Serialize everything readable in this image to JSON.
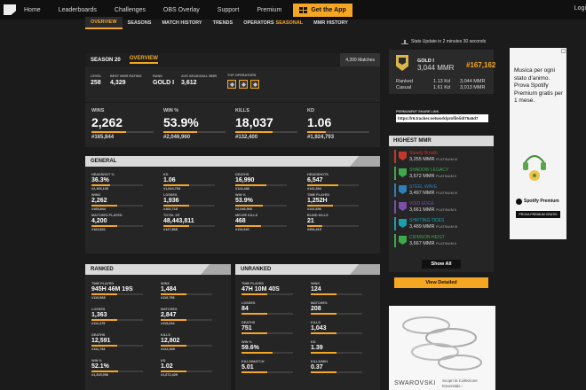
{
  "nav": {
    "items": [
      "Home",
      "Leaderboards",
      "Challenges",
      "OBS Overlay",
      "Support",
      "Premium"
    ],
    "cta": "Get the App",
    "login": "Logi"
  },
  "subtabs": [
    {
      "label": "OVERVIEW",
      "accent": ""
    },
    {
      "label": "SEASONS",
      "accent": ""
    },
    {
      "label": "MATCH HISTORY",
      "accent": ""
    },
    {
      "label": "TRENDS",
      "accent": ""
    },
    {
      "label": "OPERATORS",
      "accent": "SEASONAL"
    },
    {
      "label": "MMR HISTORY",
      "accent": ""
    }
  ],
  "season": {
    "title": "SEASON 20",
    "tab": "OVERVIEW",
    "matches": "4,200 Matches",
    "mini": [
      {
        "label": "LEVEL",
        "value": "258"
      },
      {
        "label": "BEST MMR RATING",
        "value": "4,329"
      },
      {
        "label": "RANK",
        "value": "GOLD I"
      },
      {
        "label": "AVG SEASONAL MMR",
        "value": "3,612"
      }
    ],
    "top_operators_label": "TOP OPERATORS"
  },
  "bigstats": [
    {
      "label": "WINS",
      "value": "2,262",
      "sub": "#165,844",
      "fill": 0.55
    },
    {
      "label": "WIN %",
      "value": "53.9%",
      "sub": "#2,046,960",
      "fill": 0.54
    },
    {
      "label": "KILLS",
      "value": "18,037",
      "sub": "#132,400",
      "fill": 0.6
    },
    {
      "label": "KD",
      "value": "1.06",
      "sub": "#1,924,793",
      "fill": 0.3
    }
  ],
  "general": {
    "title": "GENERAL",
    "cells": [
      {
        "label": "HEADSHOT %",
        "value": "36.3%",
        "sub": "#2,165,105",
        "fill": 0.36
      },
      {
        "label": "KD",
        "value": "1.06",
        "sub": "#1,924,793",
        "fill": 0.5
      },
      {
        "label": "DEATHS",
        "value": "16,990",
        "sub": "#124,486",
        "fill": 0.6
      },
      {
        "label": "HEADSHOTS",
        "value": "6,547",
        "sub": "#141,394",
        "fill": 0.6
      },
      {
        "label": "WINS",
        "value": "2,262",
        "sub": "#165,844",
        "fill": 0.5
      },
      {
        "label": "LOSSES",
        "value": "1,936",
        "sub": "#162,718",
        "fill": 0.5
      },
      {
        "label": "WIN %",
        "value": "53.9%",
        "sub": "#2,046,960",
        "fill": 0.54
      },
      {
        "label": "TIME PLAYED",
        "value": "1,252H",
        "sub": "#131,696",
        "fill": 0.5
      },
      {
        "label": "MATCHES PLAYED",
        "value": "4,200",
        "sub": "#164,831",
        "fill": 0.5
      },
      {
        "label": "TOTAL XP",
        "value": "48,443,811",
        "sub": "#127,868",
        "fill": 0.5
      },
      {
        "label": "MELEE KILLS",
        "value": "468",
        "sub": "#110,540",
        "fill": 0.5
      },
      {
        "label": "BLIND KILLS",
        "value": "21",
        "sub": "#354,415",
        "fill": 0.3
      }
    ]
  },
  "ranked": {
    "title": "RANKED",
    "cells": [
      {
        "label": "TIME PLAYED",
        "value": "945H 46M 19S",
        "sub": "#119,568",
        "fill": 0.5
      },
      {
        "label": "WINS",
        "value": "1,484",
        "sub": "#110,756",
        "fill": 0.5
      },
      {
        "label": "LOSSES",
        "value": "1,363",
        "sub": "#111,375",
        "fill": 0.5
      },
      {
        "label": "MATCHES",
        "value": "2,847",
        "sub": "#115,816",
        "fill": 0.5
      },
      {
        "label": "DEATHS",
        "value": "12,591",
        "sub": "#111,733",
        "fill": 0.5
      },
      {
        "label": "KILLS",
        "value": "12,802",
        "sub": "#122,469",
        "fill": 0.5
      },
      {
        "label": "WIN %",
        "value": "52.1%",
        "sub": "#1,315,096",
        "fill": 0.52
      },
      {
        "label": "KD",
        "value": "1.02",
        "sub": "#1,672,429",
        "fill": 0.5
      }
    ]
  },
  "unranked": {
    "title": "UNRANKED",
    "cells": [
      {
        "label": "TIME PLAYED",
        "value": "47H 10M 40S",
        "sub": "",
        "fill": 0.5
      },
      {
        "label": "WINS",
        "value": "124",
        "sub": "",
        "fill": 0.5
      },
      {
        "label": "LOSSES",
        "value": "84",
        "sub": "",
        "fill": 0.5
      },
      {
        "label": "MATCHES",
        "value": "208",
        "sub": "",
        "fill": 0.5
      },
      {
        "label": "DEATHS",
        "value": "751",
        "sub": "",
        "fill": 0.5
      },
      {
        "label": "KILLS",
        "value": "1,043",
        "sub": "",
        "fill": 0.5
      },
      {
        "label": "WIN %",
        "value": "59.6%",
        "sub": "",
        "fill": 0.6
      },
      {
        "label": "KD",
        "value": "1.39",
        "sub": "",
        "fill": 0.5
      },
      {
        "label": "KILLS/MATCH",
        "value": "5.01",
        "sub": "",
        "fill": 0.5
      },
      {
        "label": "KILLS/MIN",
        "value": "0.37",
        "sub": "",
        "fill": 0.5
      }
    ]
  },
  "status": {
    "text": "Stats Update in 2 minutes 30 seconds"
  },
  "rank_card": {
    "rank": "GOLD I",
    "mmr": "3,044 MMR",
    "delta": "#167,162",
    "rows": [
      {
        "label": "Ranked",
        "kd": "1.13 Kd",
        "mmr": "3,044 MMR"
      },
      {
        "label": "Casual",
        "kd": "1.61 Kd",
        "mmr": "3,013 MMR"
      }
    ]
  },
  "share": {
    "label": "PERMANENT SHARE LINK",
    "url": "https://r6.tracker.network/profile/id/75a5d7"
  },
  "highest_mmr": {
    "title": "HIGHEST MMR",
    "items": [
      {
        "season": "Steady Breath",
        "mmr": "3,255 MMR",
        "rank": "PLATINUM III",
        "color": "#c0392b"
      },
      {
        "season": "SHADOW LEGACY",
        "mmr": "3,672 MMR",
        "rank": "PLATINUM II",
        "color": "#3aaa4a"
      },
      {
        "season": "STEEL WAVE",
        "mmr": "3,497 MMR",
        "rank": "PLATINUM III",
        "color": "#2d7fb8"
      },
      {
        "season": "VOID EDGE",
        "mmr": "3,661 MMR",
        "rank": "PLATINUM II",
        "color": "#7a4fa8"
      },
      {
        "season": "SHIFTING TIDES",
        "mmr": "3,489 MMR",
        "rank": "PLATINUM III",
        "color": "#1aa0a8"
      },
      {
        "season": "CRIMSON HEIST",
        "mmr": "3,667 MMR",
        "rank": "PLATINUM II",
        "color": "#3aaa4a"
      }
    ],
    "show_all": "Show All"
  },
  "view_detailed": "View Detailed",
  "ad_spotify": {
    "text": "Musica per ogni stato d'animo. Prova Spotify Premium gratis per 1 mese.",
    "logo": "Spotify Premium",
    "button": "PROVA PREMIUM GRATIS"
  },
  "ad_swarovski": {
    "brand": "SWAROVSKI",
    "cta": "Scopri la Collezione Essentials ›"
  },
  "colors": {
    "accent": "#f5a623",
    "panel": "#2a2a2a",
    "background": "#1b1b1b"
  }
}
